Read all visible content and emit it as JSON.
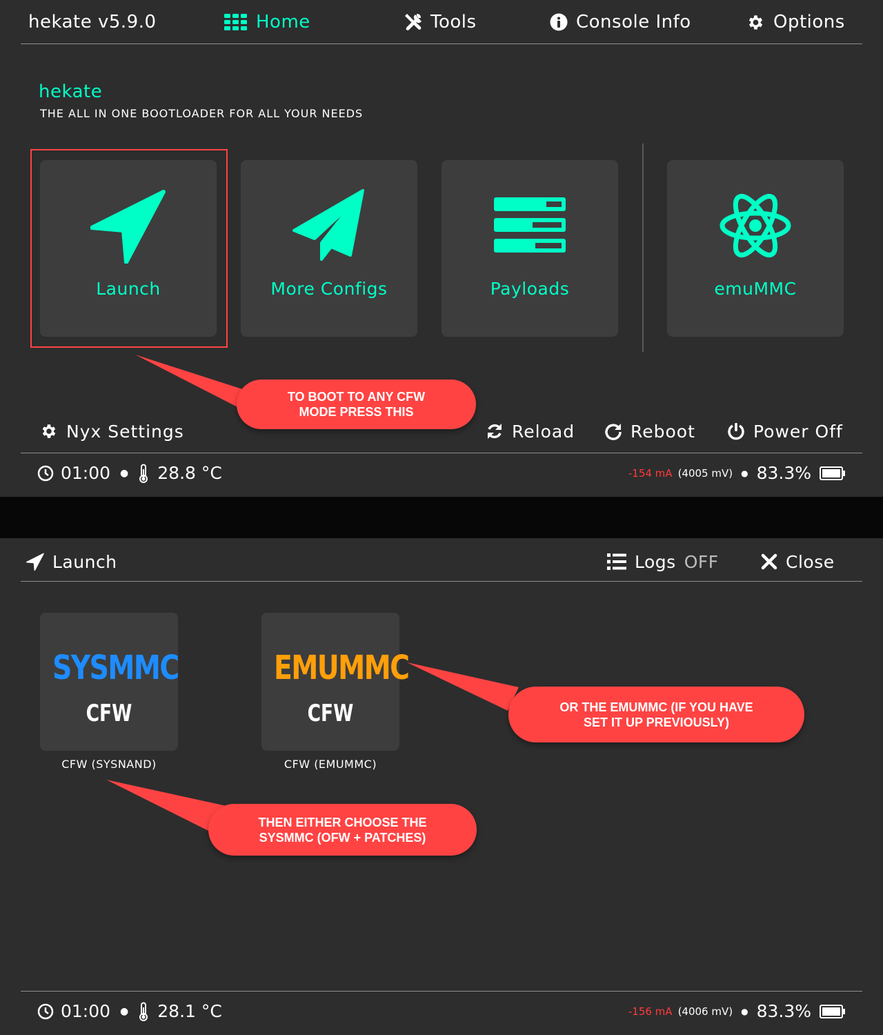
{
  "top": {
    "app_title": "hekate  v5.9.0",
    "nav": {
      "home": "Home",
      "tools": "Tools",
      "console_info": "Console Info",
      "options": "Options"
    },
    "hero_title": "hekate",
    "hero_subtitle": "THE ALL IN ONE BOOTLOADER FOR ALL YOUR NEEDS",
    "tiles": [
      {
        "label": "Launch",
        "icon": "launch-arrow-icon"
      },
      {
        "label": "More Configs",
        "icon": "paper-plane-icon"
      },
      {
        "label": "Payloads",
        "icon": "payloads-list-icon"
      },
      {
        "label": "emuMMC",
        "icon": "atom-icon"
      }
    ],
    "bottom_actions": {
      "nyx_settings": "Nyx  Settings",
      "reload": "Reload",
      "reboot": "Reboot",
      "power_off": "Power  Off"
    },
    "status": {
      "time": "01:00",
      "temperature": "28.8 °C",
      "current": "-154  mA",
      "voltage": "(4005  mV)",
      "battery": "83.3%"
    },
    "callout": "TO BOOT TO ANY CFW\nMODE PRESS THIS"
  },
  "bottom": {
    "header_title": "Launch",
    "logs_label": "Logs",
    "logs_state": "OFF",
    "close_label": "Close",
    "entries": [
      {
        "big": "SYSMMC",
        "small": "CFW",
        "caption": "CFW  (SYSNAND)",
        "color": "#1e8cff"
      },
      {
        "big": "EMUMMC",
        "small": "CFW",
        "caption": "CFW  (EMUMMC)",
        "color": "#ff9f0a"
      }
    ],
    "status": {
      "time": "01:00",
      "temperature": "28.1 °C",
      "current": "-156  mA",
      "voltage": "(4006  mV)",
      "battery": "83.3%"
    },
    "callout_emummc": "OR THE EMUMMC (IF YOU HAVE\nSET IT UP PREVIOUSLY)",
    "callout_sysmmc": "THEN EITHER CHOOSE THE\nSYSMMC (OFW + PATCHES)"
  },
  "colors": {
    "accent": "#00ffc6",
    "callout": "#ff4343",
    "background": "#2d2d2d",
    "tile": "#3d3d3d"
  }
}
